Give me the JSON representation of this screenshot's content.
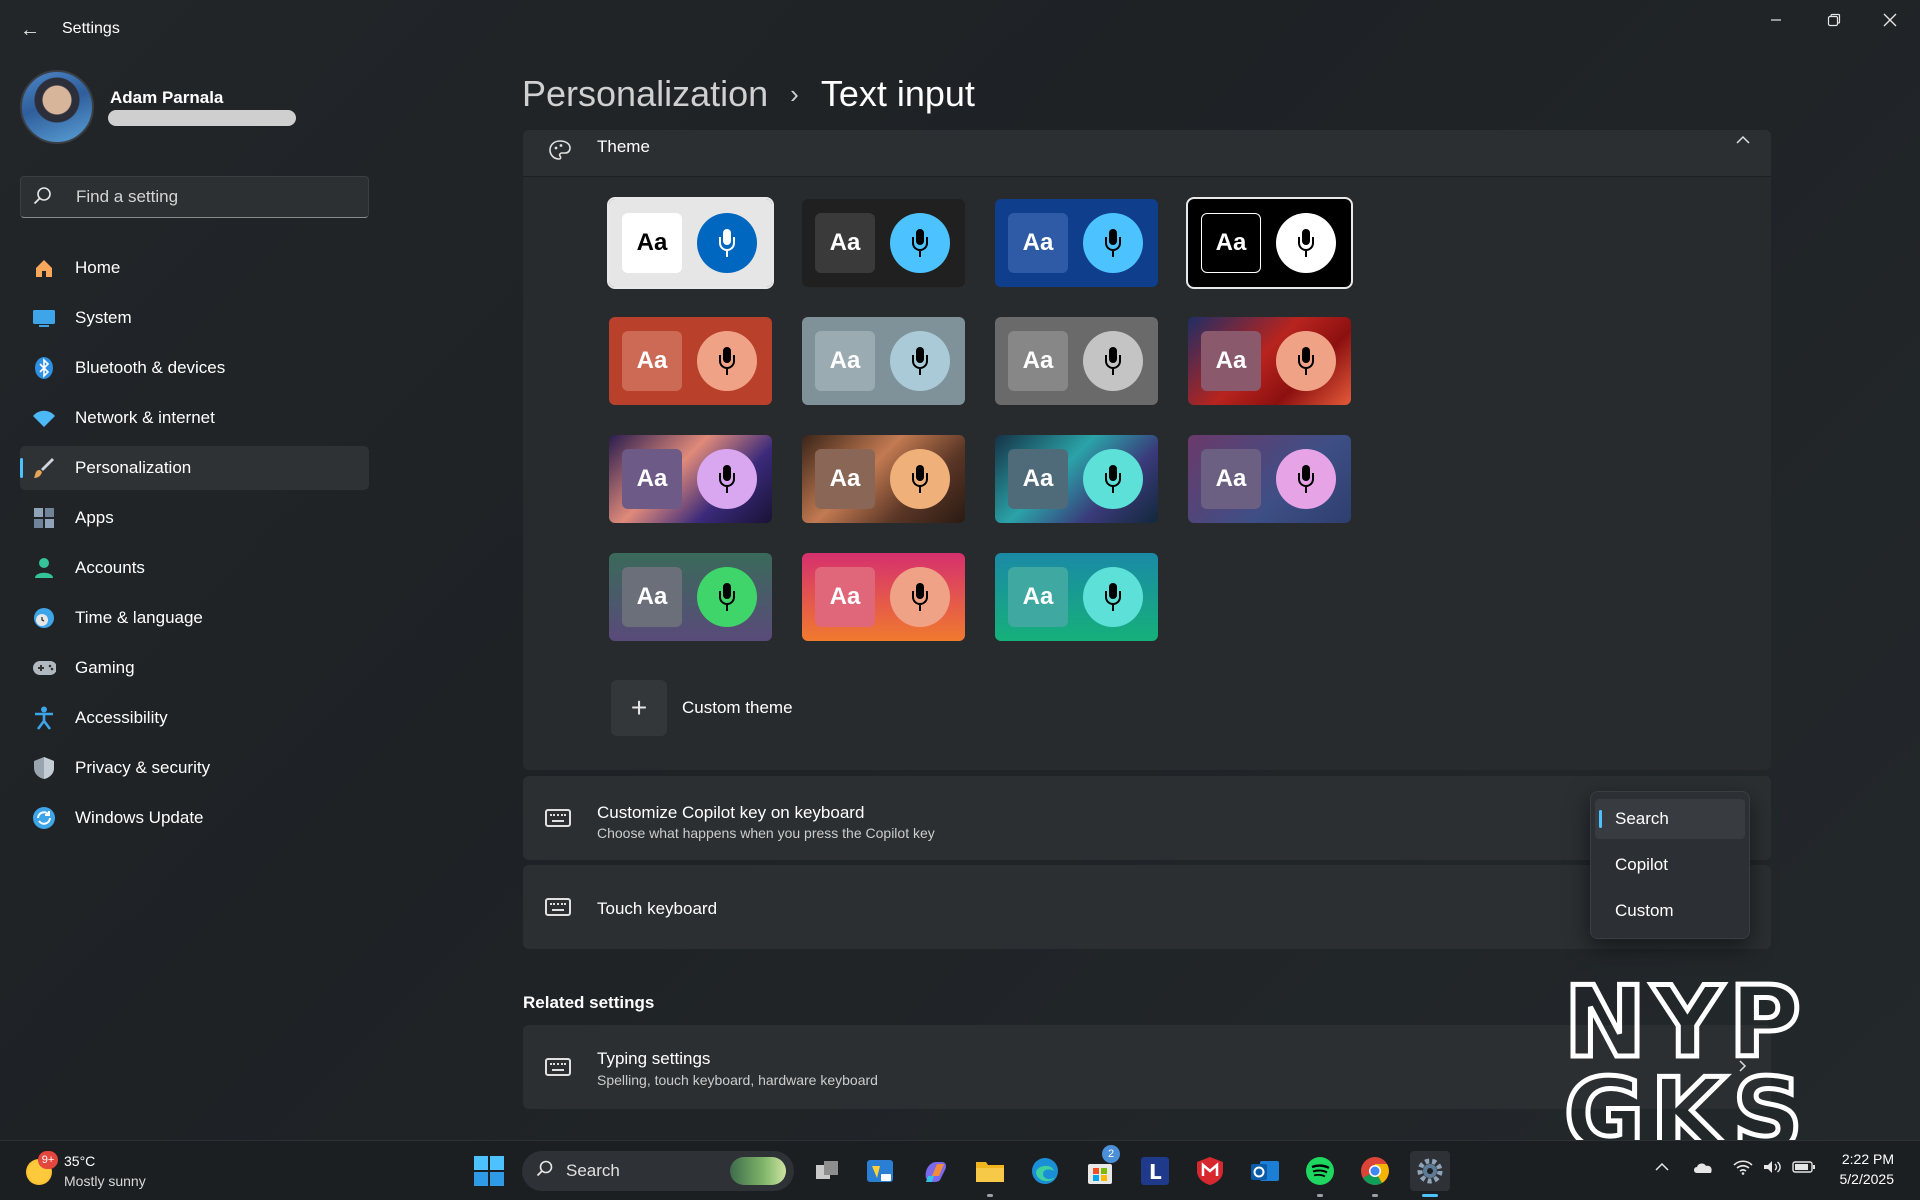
{
  "window": {
    "title": "Settings",
    "back_icon": "back-arrow-icon",
    "controls": [
      "minimize-icon",
      "restore-icon",
      "close-icon"
    ]
  },
  "profile": {
    "name": "Adam Parnala"
  },
  "search": {
    "placeholder": "Find a setting"
  },
  "sidebar": {
    "items": [
      {
        "label": "Home",
        "icon": "home-icon",
        "color": "#f7a85a"
      },
      {
        "label": "System",
        "icon": "system-icon",
        "color": "#3ea6e8"
      },
      {
        "label": "Bluetooth & devices",
        "icon": "bluetooth-icon",
        "color": "#2f8fe0"
      },
      {
        "label": "Network & internet",
        "icon": "wifi-icon",
        "color": "#4cb8f5"
      },
      {
        "label": "Personalization",
        "icon": "brush-icon",
        "color": "#e6a35a",
        "active": true
      },
      {
        "label": "Apps",
        "icon": "apps-icon",
        "color": "#8fa4b8"
      },
      {
        "label": "Accounts",
        "icon": "person-icon",
        "color": "#35c49a"
      },
      {
        "label": "Time & language",
        "icon": "clock-globe-icon",
        "color": "#3ea6e8"
      },
      {
        "label": "Gaming",
        "icon": "gamepad-icon",
        "color": "#b0b8c0"
      },
      {
        "label": "Accessibility",
        "icon": "accessibility-icon",
        "color": "#3ea6e8"
      },
      {
        "label": "Privacy & security",
        "icon": "shield-icon",
        "color": "#9aa4ae"
      },
      {
        "label": "Windows Update",
        "icon": "update-icon",
        "color": "#3ea6e8"
      }
    ]
  },
  "header": {
    "parent": "Personalization",
    "separator": "›",
    "current": "Text input"
  },
  "theme": {
    "title": "Theme",
    "aa_label": "Aa",
    "custom_label": "Custom theme",
    "tiles": [
      {
        "bg": "#e6e6e6",
        "aa_bg": "#ffffff",
        "aa_fg": "#000000",
        "mic_bg": "#0067c0",
        "mic_fg": "#ffffff",
        "selected": true
      },
      {
        "bg": "#202020",
        "aa_bg": "#3a3a3a",
        "aa_fg": "#ffffff",
        "mic_bg": "#4cc2ff",
        "mic_fg": "#000000"
      },
      {
        "bg": "#0f3f8c",
        "aa_bg": "#2f5ba6",
        "aa_fg": "#ffffff",
        "mic_bg": "#4cc2ff",
        "mic_fg": "#000000"
      },
      {
        "bg": "#000000",
        "aa_bg": "#000000",
        "aa_fg": "#ffffff",
        "aa_border": "#ffffff",
        "mic_bg": "#ffffff",
        "mic_fg": "#000000",
        "selected": true
      },
      {
        "bg": "#b9402a",
        "aa_bg": "#cc6a55",
        "aa_fg": "#ffffff",
        "mic_bg": "#f0a287",
        "mic_fg": "#000000"
      },
      {
        "bg": "#7f9299",
        "aa_bg": "#9aabb1",
        "aa_fg": "#ffffff",
        "mic_bg": "#a9cad6",
        "mic_fg": "#000000"
      },
      {
        "bg": "#6a6a6a",
        "aa_bg": "#878787",
        "aa_fg": "#ffffff",
        "mic_bg": "#c4c4c4",
        "mic_fg": "#000000"
      },
      {
        "bg": "linear-gradient(135deg,#1f2e66 0%,#b8241e 45%,#8c1010 70%,#e45a3a 100%)",
        "aa_bg": "#8a5a6c",
        "aa_fg": "#ffffff",
        "mic_bg": "#f0a287",
        "mic_fg": "#000000"
      },
      {
        "bg": "linear-gradient(135deg,#2a1d4f 0%,#e08a7a 40%,#3a2a7a 70%,#1a1236 100%)",
        "aa_bg": "#6d5a86",
        "aa_fg": "#ffffff",
        "mic_bg": "#d9a6f0",
        "mic_fg": "#000000"
      },
      {
        "bg": "linear-gradient(135deg,#3a2418 0%,#c27a52 40%,#5a3626 70%,#2a1a12 100%)",
        "aa_bg": "#8a6656",
        "aa_fg": "#ffffff",
        "mic_bg": "#f0b07a",
        "mic_fg": "#000000"
      },
      {
        "bg": "linear-gradient(135deg,#163246 0%,#2aa3a8 40%,#3a3a7a 70%,#12283a 100%)",
        "aa_bg": "#4f6a78",
        "aa_fg": "#ffffff",
        "mic_bg": "#5ce0d8",
        "mic_fg": "#000000"
      },
      {
        "bg": "linear-gradient(135deg,#6a3a6a 0%,#3e4f86 60%,#2e3e6e 100%)",
        "aa_bg": "#6c6082",
        "aa_fg": "#ffffff",
        "mic_bg": "#e6a3e6",
        "mic_fg": "#000000"
      },
      {
        "bg": "linear-gradient(180deg,#3a6a5a 0%,#5a4a7a 100%)",
        "aa_bg": "#6a6f7a",
        "aa_fg": "#ffffff",
        "mic_bg": "#3fd56a",
        "mic_fg": "#000000"
      },
      {
        "bg": "linear-gradient(180deg,#d6306e 0%,#f07a2e 100%)",
        "aa_bg": "#e0667a",
        "aa_fg": "#ffffff",
        "mic_bg": "#f0a287",
        "mic_fg": "#000000"
      },
      {
        "bg": "linear-gradient(180deg,#1a8aa6 0%,#16b07a 100%)",
        "aa_bg": "#3fa8a0",
        "aa_fg": "#ffffff",
        "mic_bg": "#5ce0d8",
        "mic_fg": "#000000"
      }
    ]
  },
  "copilot_row": {
    "title": "Customize Copilot key on keyboard",
    "subtitle": "Choose what happens when you press the Copilot key",
    "icon": "keyboard-icon"
  },
  "touch_row": {
    "title": "Touch keyboard",
    "icon": "keyboard-icon"
  },
  "dropdown": {
    "options": [
      "Search",
      "Copilot",
      "Custom"
    ],
    "selected": "Search"
  },
  "related": {
    "heading": "Related settings",
    "typing": {
      "title": "Typing settings",
      "subtitle": "Spelling, touch keyboard, hardware keyboard",
      "icon": "keyboard-icon"
    }
  },
  "watermark": {
    "line1": "NYP",
    "line2": "GKS"
  },
  "taskbar": {
    "weather": {
      "badge": "9+",
      "temp": "35°C",
      "desc": "Mostly sunny"
    },
    "search_label": "Search",
    "store_badge": "2",
    "clock": {
      "time": "2:22 PM",
      "date": "5/2/2025"
    }
  }
}
